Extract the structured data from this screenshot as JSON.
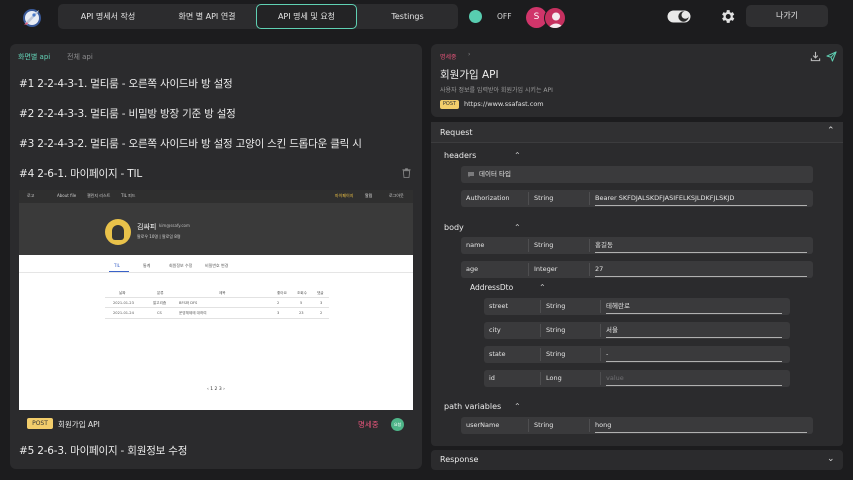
{
  "nav": {
    "tabs": [
      {
        "label": "API 명세서 작성"
      },
      {
        "label": "화면 별 API 연결"
      },
      {
        "label": "API 명세 및 요청"
      },
      {
        "label": "Testings"
      }
    ],
    "active_tab_index": 2,
    "sync_toggle_label": "OFF",
    "user_initial": "S",
    "logout_label": "나가기",
    "accent_color": "#5fd0b3"
  },
  "left": {
    "tabs": [
      {
        "label": "화면별 api"
      },
      {
        "label": "전체 api"
      }
    ],
    "items": [
      {
        "title": "#1 2-2-4-3-1. 멀티룸 - 오른쪽 사이드바 방 설정"
      },
      {
        "title": "#2 2-2-4-3-3. 멀티룸 - 비밀방 방장 기준 방 설정"
      },
      {
        "title": "#3 2-2-4-3-2. 멀티룸 - 오른쪽 사이드바 방 설정 고양이 스킨 드롭다운 클릭 시"
      },
      {
        "title": "#4 2-6-1. 마이페이지 - TIL"
      },
      {
        "title": "#5 2-6-3. 마이페이지 - 회원정보 수정"
      }
    ],
    "preview": {
      "nav": {
        "logo": "로고",
        "links": [
          "About file",
          "챌린지 리스트",
          "TIL 피드"
        ],
        "right": [
          "마이페이지",
          "알림",
          "로그아웃"
        ]
      },
      "profile": {
        "name": "김싸피",
        "email": "kim@ssafy.com",
        "stats": "팔로우 10명  |  팔로잉 8명"
      },
      "tabs": [
        "TIL",
        "통계",
        "회원정보 수정",
        "비밀번호 변경"
      ],
      "table_headers": [
        "날짜",
        "분류",
        "제목",
        "좋아요",
        "조회수",
        "댓글"
      ],
      "rows": [
        [
          "2021-01-23",
          "알고리즘",
          "BFS와 DFS",
          "2",
          "5",
          "3"
        ],
        [
          "2021-01-24",
          "CS",
          "운영체제에 대하여",
          "3",
          "23",
          "2"
        ]
      ],
      "pagination": "‹  1  2  3  ›"
    },
    "api_link": {
      "method": "POST",
      "name": "회원가입 API",
      "status": "명세중",
      "status_badge": "요청"
    }
  },
  "detail": {
    "status": "명세중",
    "title": "회원가입 API",
    "description": "사용자 정보를 입력받아 회원가입 시키는 API",
    "method": "POST",
    "url": "https://www.ssafast.com"
  },
  "request": {
    "title": "Request",
    "headers_label": "headers",
    "header_type_label": "데이터 타입",
    "header_rows": [
      {
        "key": "Authorization",
        "type": "String",
        "value": "Bearer  SKFDJALSKDFJASIFELKSJLDKFJLSKJD"
      }
    ],
    "body_label": "body",
    "body_rows": [
      {
        "key": "name",
        "type": "String",
        "value": "홍길동"
      },
      {
        "key": "age",
        "type": "Integer",
        "value": "27"
      }
    ],
    "address": {
      "label": "AddressDto",
      "rows": [
        {
          "key": "street",
          "type": "String",
          "value": "테헤란로"
        },
        {
          "key": "city",
          "type": "String",
          "value": "서울"
        },
        {
          "key": "state",
          "type": "String",
          "value": "-"
        },
        {
          "key": "id",
          "type": "Long",
          "value": "",
          "placeholder": "value"
        }
      ]
    },
    "path_label": "path variables",
    "path_rows": [
      {
        "key": "userName",
        "type": "String",
        "value": "hong"
      }
    ]
  },
  "response": {
    "title": "Response"
  }
}
